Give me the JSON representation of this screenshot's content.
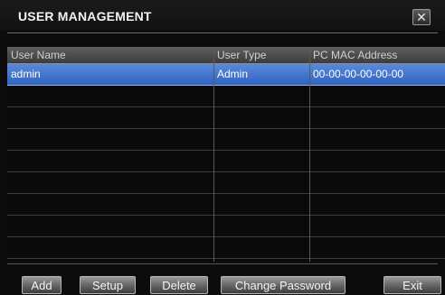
{
  "window": {
    "title": "USER MANAGEMENT",
    "close_label": "✕"
  },
  "table": {
    "columns": [
      "User Name",
      "User Type",
      "PC MAC Address"
    ],
    "rows": [
      {
        "user_name": "admin",
        "user_type": "Admin",
        "mac": "00-00-00-00-00-00",
        "selected": true
      },
      {
        "user_name": "",
        "user_type": "",
        "mac": ""
      },
      {
        "user_name": "",
        "user_type": "",
        "mac": ""
      },
      {
        "user_name": "",
        "user_type": "",
        "mac": ""
      },
      {
        "user_name": "",
        "user_type": "",
        "mac": ""
      },
      {
        "user_name": "",
        "user_type": "",
        "mac": ""
      },
      {
        "user_name": "",
        "user_type": "",
        "mac": ""
      },
      {
        "user_name": "",
        "user_type": "",
        "mac": ""
      },
      {
        "user_name": "",
        "user_type": "",
        "mac": ""
      }
    ]
  },
  "buttons": {
    "add": "Add",
    "setup": "Setup",
    "delete": "Delete",
    "change_password": "Change Password",
    "exit": "Exit"
  },
  "colors": {
    "selected_row": "#3f72cc",
    "background": "#0c0c0c"
  }
}
